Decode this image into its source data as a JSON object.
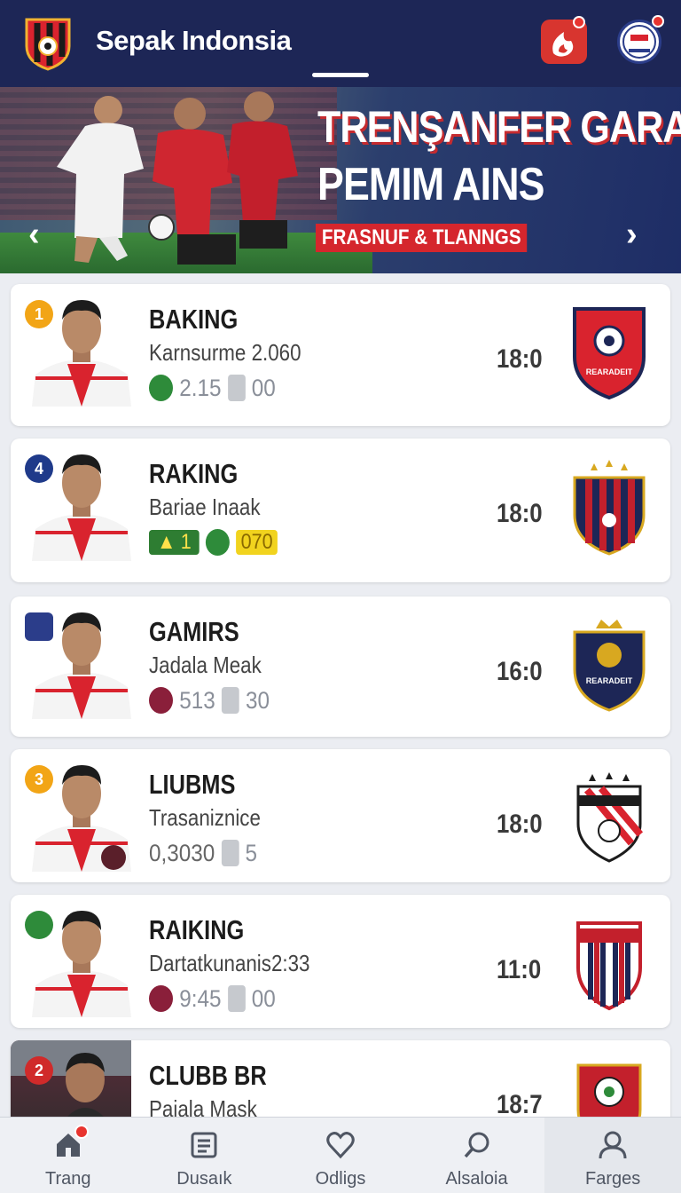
{
  "header": {
    "title": "Sepak Indonsia"
  },
  "banner": {
    "title_line1": "TRENŞANFER GARA",
    "title_line2": "PEMIM AINS",
    "tag": "FRASNUF & TLANNGS",
    "prev_icon": "‹",
    "next_icon": "›"
  },
  "cards": [
    {
      "rank": "1",
      "rank_color": "#f2a516",
      "name": "BAKING",
      "sub": "Karnsurme 2.060",
      "stat1": "2.15",
      "stat2": "00",
      "time": "18:0"
    },
    {
      "rank": "4",
      "rank_color": "#1f3a8a",
      "name": "RAKING",
      "sub": "Bariae Inaak",
      "stat1": "1",
      "stat2": "070",
      "time": "18:0"
    },
    {
      "rank": "",
      "rank_color": "#2b3d8a",
      "name": "GAMIRS",
      "sub": "Jadala Meak",
      "stat1": "513",
      "stat2": "30",
      "time": "16:0"
    },
    {
      "rank": "3",
      "rank_color": "#f2a516",
      "name": "LIUBMS",
      "sub": "Trasaniznice",
      "stat1": "0,3030",
      "stat2": "5",
      "time": "18:0"
    },
    {
      "rank": "",
      "rank_color": "#2e8b3a",
      "name": "RAIKING",
      "sub": "Dartatkunanis2:33",
      "stat1": "9:45",
      "stat2": "00",
      "time": "11:0"
    },
    {
      "rank": "2",
      "rank_color": "#d02a2a",
      "name": "CLUBB BR",
      "sub": "Paiala Mask",
      "stat1": "",
      "stat2": "",
      "time": "18:7"
    }
  ],
  "crest_text": {
    "c1": "REARADEIT",
    "c3": "REARADEIT"
  },
  "nav": {
    "items": [
      {
        "label": "Trang",
        "icon": "home-icon"
      },
      {
        "label": "Dusaık",
        "icon": "list-icon"
      },
      {
        "label": "Odligs",
        "icon": "heart-icon"
      },
      {
        "label": "Alsaloia",
        "icon": "search-icon"
      },
      {
        "label": "Farges",
        "icon": "profile-icon"
      }
    ]
  },
  "colors": {
    "header": "#1d2656",
    "accent_red": "#d5262d",
    "card_bg": "#ffffff"
  }
}
